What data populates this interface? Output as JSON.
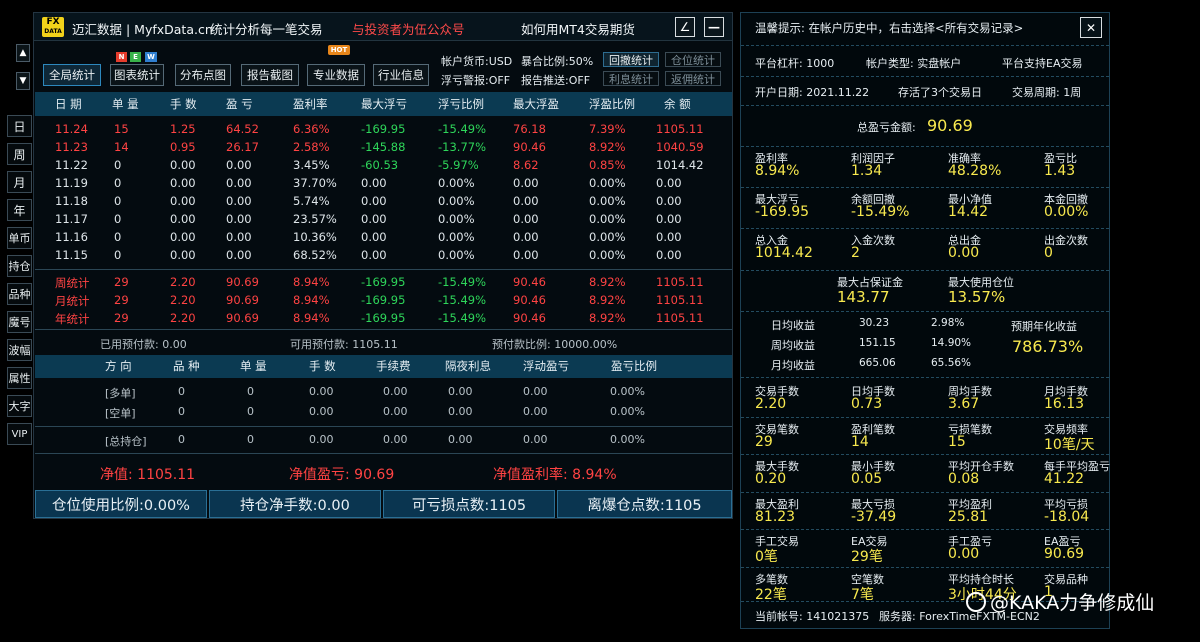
{
  "left_strip": {
    "items": [
      "日",
      "周",
      "月",
      "年",
      "单币",
      "持仓",
      "品种",
      "魔号",
      "波幅",
      "属性",
      "大字",
      "VIP"
    ]
  },
  "title_bar": {
    "logo_top": "FX",
    "logo_bottom": "DATA",
    "app_name": "迈汇数据 | MyfxData.cn",
    "slogan": "统计分析每一笔交易",
    "promo": "与投资者为伍公众号",
    "link": "如何用MT4交易期货",
    "draw_icon": "∠",
    "min_icon": "—"
  },
  "toolbar": {
    "buttons": [
      "全局统计",
      "图表统计",
      "分布点图",
      "报告截图",
      "专业数据",
      "行业信息"
    ],
    "badge_new": [
      "N",
      "E",
      "W"
    ],
    "badge_hot": "HOT",
    "account_currency": "帐户货币:USD",
    "float_alert": "浮亏警报:OFF",
    "exposure": "暴合比例:50%",
    "report_push": "报告推送:OFF",
    "small_buttons": [
      "回撤统计",
      "仓位统计",
      "利息统计",
      "返佣统计"
    ]
  },
  "daily_table": {
    "headers": [
      "日 期",
      "单 量",
      "手 数",
      "盈 亏",
      "盈利率",
      "最大浮亏",
      "浮亏比例",
      "最大浮盈",
      "浮盈比例",
      "余 额"
    ],
    "rows": [
      [
        "11.24",
        "15",
        "1.25",
        "64.52",
        "6.36%",
        "-169.95",
        "-15.49%",
        "76.18",
        "7.39%",
        "1105.11"
      ],
      [
        "11.23",
        "14",
        "0.95",
        "26.17",
        "2.58%",
        "-145.88",
        "-13.77%",
        "90.46",
        "8.92%",
        "1040.59"
      ],
      [
        "11.22",
        "0",
        "0.00",
        "0.00",
        "3.45%",
        "-60.53",
        "-5.97%",
        "8.62",
        "0.85%",
        "1014.42"
      ],
      [
        "11.19",
        "0",
        "0.00",
        "0.00",
        "37.70%",
        "0.00",
        "0.00%",
        "0.00",
        "0.00%",
        "0.00"
      ],
      [
        "11.18",
        "0",
        "0.00",
        "0.00",
        "5.74%",
        "0.00",
        "0.00%",
        "0.00",
        "0.00%",
        "0.00"
      ],
      [
        "11.17",
        "0",
        "0.00",
        "0.00",
        "23.57%",
        "0.00",
        "0.00%",
        "0.00",
        "0.00%",
        "0.00"
      ],
      [
        "11.16",
        "0",
        "0.00",
        "0.00",
        "10.36%",
        "0.00",
        "0.00%",
        "0.00",
        "0.00%",
        "0.00"
      ],
      [
        "11.15",
        "0",
        "0.00",
        "0.00",
        "68.52%",
        "0.00",
        "0.00%",
        "0.00",
        "0.00%",
        "0.00"
      ]
    ],
    "summary": [
      [
        "周统计",
        "29",
        "2.20",
        "90.69",
        "8.94%",
        "-169.95",
        "-15.49%",
        "90.46",
        "8.92%",
        "1105.11"
      ],
      [
        "月统计",
        "29",
        "2.20",
        "90.69",
        "8.94%",
        "-169.95",
        "-15.49%",
        "90.46",
        "8.92%",
        "1105.11"
      ],
      [
        "年统计",
        "29",
        "2.20",
        "90.69",
        "8.94%",
        "-169.95",
        "-15.49%",
        "90.46",
        "8.92%",
        "1105.11"
      ]
    ],
    "prepay": [
      "已用预付款: 0.00",
      "可用预付款: 1105.11",
      "预付款比例: 10000.00%"
    ]
  },
  "position_table": {
    "headers": [
      "方 向",
      "品 种",
      "单 量",
      "手 数",
      "手续费",
      "隔夜利息",
      "浮动盈亏",
      "盈亏比例"
    ],
    "rows": [
      [
        "[多单]",
        "0",
        "0",
        "0.00",
        "0.00",
        "0.00",
        "0.00",
        "0.00%"
      ],
      [
        "[空单]",
        "0",
        "0",
        "0.00",
        "0.00",
        "0.00",
        "0.00",
        "0.00%"
      ],
      [
        "[总持仓]",
        "0",
        "0",
        "0.00",
        "0.00",
        "0.00",
        "0.00",
        "0.00%"
      ]
    ]
  },
  "net": {
    "equity": "净值: 1105.11",
    "equity_pl": "净值盈亏: 90.69",
    "equity_rate": "净值盈利率: 8.94%"
  },
  "footer": [
    "仓位使用比例:0.00%",
    "持仓净手数:0.00",
    "可亏损点数:1105",
    "离爆仓点数:1105"
  ],
  "right": {
    "tip": "温馨提示: 在帐户历史中，右击选择<所有交易记录>",
    "close_icon": "✕",
    "info1": [
      "平台杠杆: 1000",
      "帐户类型: 实盘帐户",
      "平台支持EA交易"
    ],
    "info2": [
      "开户日期: 2021.11.22",
      "存活了3个交易日",
      "交易周期: 1周"
    ],
    "total_pl_label": "总盈亏金额:",
    "total_pl_value": "90.69",
    "grid1": [
      [
        "盈利率",
        "8.94%"
      ],
      [
        "利润因子",
        "1.34"
      ],
      [
        "准确率",
        "48.28%"
      ],
      [
        "盈亏比",
        "1.43"
      ],
      [
        "最大浮亏",
        "-169.95"
      ],
      [
        "余额回撤",
        "-15.49%"
      ],
      [
        "最小净值",
        "14.42"
      ],
      [
        "本金回撤",
        "0.00%"
      ],
      [
        "总入金",
        "1014.42"
      ],
      [
        "入金次数",
        "2"
      ],
      [
        "总出金",
        "0.00"
      ],
      [
        "出金次数",
        "0"
      ]
    ],
    "margin": [
      [
        "最大占保证金",
        "143.77"
      ],
      [
        "最大使用仓位",
        "13.57%"
      ]
    ],
    "avg": {
      "rows": [
        [
          "日均收益",
          "30.23",
          "2.98%"
        ],
        [
          "周均收益",
          "151.15",
          "14.90%"
        ],
        [
          "月均收益",
          "665.06",
          "65.56%"
        ]
      ],
      "annual_label": "预期年化收益",
      "annual_value": "786.73%"
    },
    "grid2": [
      [
        "交易手数",
        "2.20"
      ],
      [
        "日均手数",
        "0.73"
      ],
      [
        "周均手数",
        "3.67"
      ],
      [
        "月均手数",
        "16.13"
      ],
      [
        "交易笔数",
        "29"
      ],
      [
        "盈利笔数",
        "14"
      ],
      [
        "亏损笔数",
        "15"
      ],
      [
        "交易频率",
        "10笔/天"
      ],
      [
        "最大手数",
        "0.20"
      ],
      [
        "最小手数",
        "0.05"
      ],
      [
        "平均开仓手数",
        "0.08"
      ],
      [
        "每手平均盈亏",
        "41.22"
      ],
      [
        "最大盈利",
        "81.23"
      ],
      [
        "最大亏损",
        "-37.49"
      ],
      [
        "平均盈利",
        "25.81"
      ],
      [
        "平均亏损",
        "-18.04"
      ],
      [
        "手工交易",
        "0笔"
      ],
      [
        "EA交易",
        "29笔"
      ],
      [
        "手工盈亏",
        "0.00"
      ],
      [
        "EA盈亏",
        "90.69"
      ],
      [
        "多笔数",
        "22笔"
      ],
      [
        "空笔数",
        "7笔"
      ],
      [
        "平均持仓时长",
        "3小时44分"
      ],
      [
        "交易品种",
        "1"
      ]
    ],
    "bottom": [
      "当前帐号: 141021375",
      "服务器: ForexTimeFXTM-ECN2"
    ]
  },
  "watermark": "@KAKA力争修成仙",
  "colors": {
    "accent": "#0b3a52",
    "profit": "#ff4343",
    "loss": "#2ed65a",
    "highlight": "#f8e94f"
  }
}
